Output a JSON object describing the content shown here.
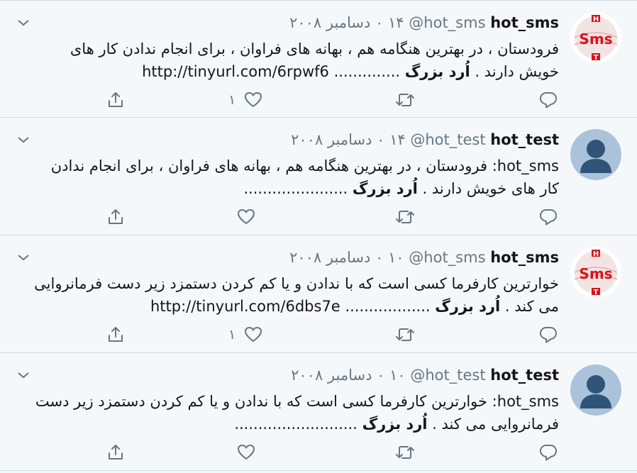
{
  "tweets": [
    {
      "avatar": "sms-logo",
      "name": "hot_sms",
      "handle": "@hot_sms",
      "time": "۱۴ ۰ دسامبر ۲۰۰۸",
      "text_prefix": "فرودستان ، در بهترین هنگامه هم ، بهانه های فراوان ، برای انجام ندادن کار های خویش دارند . ",
      "signature": "اُرد بزرگ",
      "text_suffix": " ..............",
      "link": "http://tinyurl.com/6rpwf6",
      "like_count": "۱"
    },
    {
      "avatar": "default-profile",
      "name": "hot_test",
      "handle": "@hot_test",
      "time": "۱۴ ۰ دسامبر ۲۰۰۸",
      "text_prefix": "hot_sms: فرودستان ، در بهترین هنگامه هم ، بهانه های فراوان ، برای انجام ندادن کار های خویش دارند . ",
      "signature": "اُرد بزرگ",
      "text_suffix": " ......................",
      "link": "",
      "like_count": ""
    },
    {
      "avatar": "sms-logo",
      "name": "hot_sms",
      "handle": "@hot_sms",
      "time": "۱۰ ۰ دسامبر ۲۰۰۸",
      "text_prefix": "خوارترین کارفرما کسی است که با ندادن و یا کم کردن دستمزد زیر دست فرمانروایی می کند . ",
      "signature": "اُرد بزرگ",
      "text_suffix": " ..................",
      "link": "http://tinyurl.com/6dbs7e",
      "like_count": "۱"
    },
    {
      "avatar": "default-profile",
      "name": "hot_test",
      "handle": "@hot_test",
      "time": "۱۰ ۰ دسامبر ۲۰۰۸",
      "text_prefix": "hot_sms: خوارترین کارفرما کسی است که با ندادن و یا کم کردن دستمزد زیر دست فرمانروایی می کند . ",
      "signature": "اُرد بزرگ",
      "text_suffix": " ..........................",
      "link": "",
      "like_count": ""
    }
  ],
  "colors": {
    "background": "#f5f8fa",
    "divider": "#cfdde6",
    "icon": "#657786",
    "text": "#14171a",
    "sms_logo_red": "#d7141a",
    "default_avatar_bg": "#aac3db",
    "default_avatar_fg": "#2f5478"
  },
  "icons": {
    "menu": "chevron-down-icon",
    "reply": "reply-icon",
    "retweet": "retweet-icon",
    "like": "heart-icon",
    "share": "share-icon"
  }
}
